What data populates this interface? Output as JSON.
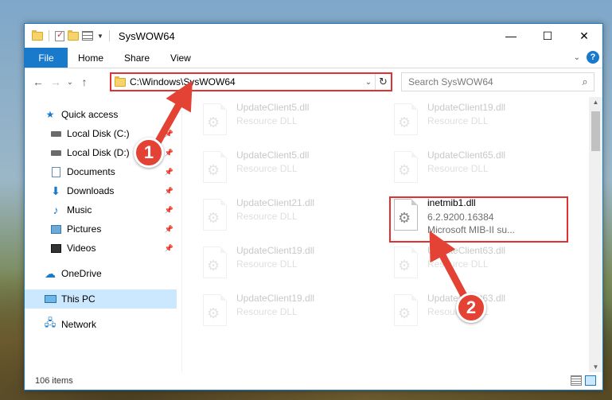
{
  "window": {
    "title": "SysWOW64"
  },
  "ribbon": {
    "tabs": [
      "File",
      "Home",
      "Share",
      "View"
    ],
    "help": "?"
  },
  "titlebar": {
    "minimize": "—",
    "maximize": "☐",
    "close": "✕"
  },
  "navbar": {
    "back": "←",
    "forward": "→",
    "recent": "⌄",
    "up": "↑",
    "address": "C:\\Windows\\SysWOW64",
    "search_placeholder": "Search SysWOW64"
  },
  "sidebar": {
    "quick_access": "Quick access",
    "items": [
      {
        "label": "Local Disk (C:)",
        "icon": "drive-icon"
      },
      {
        "label": "Local Disk (D:)",
        "icon": "drive-icon"
      },
      {
        "label": "Documents",
        "icon": "documents-icon"
      },
      {
        "label": "Downloads",
        "icon": "downloads-icon"
      },
      {
        "label": "Music",
        "icon": "music-icon"
      },
      {
        "label": "Pictures",
        "icon": "pictures-icon"
      },
      {
        "label": "Videos",
        "icon": "videos-icon"
      }
    ],
    "onedrive": "OneDrive",
    "this_pc": "This PC",
    "network": "Network"
  },
  "files": {
    "c1": [
      {
        "name": "UpdateClient5.dll",
        "type": "Resource DLL"
      },
      {
        "name": "UpdateClient5.dll",
        "type": "Resource DLL"
      },
      {
        "name": "UpdateClient21.dll",
        "type": "Resource DLL"
      },
      {
        "name": "UpdateClient19.dll",
        "type": "Resource DLL"
      },
      {
        "name": "UpdateClient19.dll",
        "type": "Resource DLL"
      }
    ],
    "c2": [
      {
        "name": "UpdateClient19.dll",
        "type": "Resource DLL"
      },
      {
        "name": "UpdateClient65.dll",
        "type": "Resource DLL"
      },
      {
        "name": "inetmib1.dll",
        "version": "6.2.9200.16384",
        "type": "Microsoft MIB-II su..."
      },
      {
        "name": "UpdateClient63.dll",
        "type": "Resource DLL"
      },
      {
        "name": "UpdateClient63.dll",
        "type": "Resource DLL"
      }
    ]
  },
  "status": {
    "count": "106 items"
  },
  "annotations": {
    "one": "1",
    "two": "2",
    "color": "#e34234"
  }
}
